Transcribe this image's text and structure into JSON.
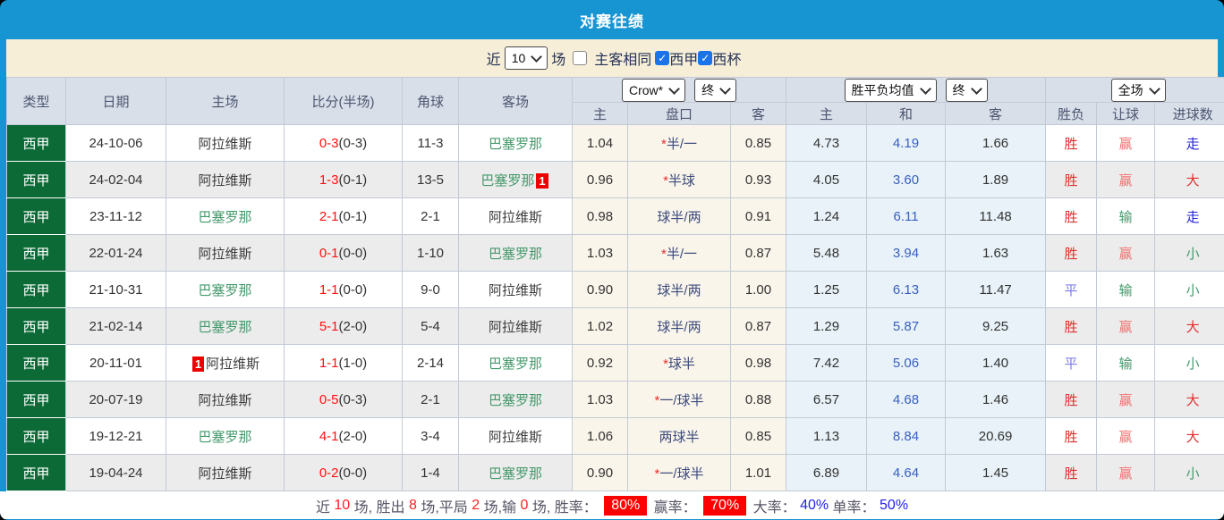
{
  "title": "对赛往绩",
  "filter": {
    "near_label": "近",
    "count_value": "10",
    "games_label": "场",
    "same_venue_label": "主客相同",
    "league_label": "西甲",
    "cup_label": "西杯"
  },
  "table": {
    "headers": {
      "type": "类型",
      "date": "日期",
      "home": "主场",
      "score": "比分(半场)",
      "corners": "角球",
      "away": "客场"
    },
    "selects": [
      {
        "label": "Crow*"
      },
      {
        "label": "终"
      },
      {
        "label": "胜平负均值"
      },
      {
        "label": "终"
      },
      {
        "label": "全场"
      }
    ],
    "subheaders": [
      "主",
      "盘口",
      "客",
      "主",
      "和",
      "客",
      "胜负",
      "让球",
      "进球数"
    ],
    "rows": [
      {
        "league": "西甲",
        "date": "24-10-06",
        "home": "阿拉维斯",
        "home_green": false,
        "home_badge": "",
        "score": "0-3",
        "half": "(0-3)",
        "corners": "11-3",
        "away": "巴塞罗那",
        "away_green": true,
        "away_badge": "",
        "odds1": "1.04",
        "handicap_star": true,
        "handicap": "半/一",
        "odds2": "0.85",
        "mean1": "4.73",
        "meanx": "4.19",
        "mean2": "1.66",
        "result": "胜",
        "result_c": "red",
        "let": "赢",
        "let_c": "pink",
        "goal": "走",
        "goal_c": "blue"
      },
      {
        "league": "西甲",
        "date": "24-02-04",
        "home": "阿拉维斯",
        "home_green": false,
        "home_badge": "",
        "score": "1-3",
        "half": "(0-1)",
        "corners": "13-5",
        "away": "巴塞罗那",
        "away_green": true,
        "away_badge": "1",
        "odds1": "0.96",
        "handicap_star": true,
        "handicap": "半球",
        "odds2": "0.93",
        "mean1": "4.05",
        "meanx": "3.60",
        "mean2": "1.89",
        "result": "胜",
        "result_c": "red",
        "let": "赢",
        "let_c": "pink",
        "goal": "大",
        "goal_c": "red"
      },
      {
        "league": "西甲",
        "date": "23-11-12",
        "home": "巴塞罗那",
        "home_green": true,
        "home_badge": "",
        "score": "2-1",
        "half": "(0-1)",
        "corners": "2-1",
        "away": "阿拉维斯",
        "away_green": false,
        "away_badge": "",
        "odds1": "0.98",
        "handicap_star": false,
        "handicap": "球半/两",
        "odds2": "0.91",
        "mean1": "1.24",
        "meanx": "6.11",
        "mean2": "11.48",
        "result": "胜",
        "result_c": "red",
        "let": "输",
        "let_c": "green",
        "goal": "走",
        "goal_c": "blue"
      },
      {
        "league": "西甲",
        "date": "22-01-24",
        "home": "阿拉维斯",
        "home_green": false,
        "home_badge": "",
        "score": "0-1",
        "half": "(0-0)",
        "corners": "1-10",
        "away": "巴塞罗那",
        "away_green": true,
        "away_badge": "",
        "odds1": "1.03",
        "handicap_star": true,
        "handicap": "半/一",
        "odds2": "0.87",
        "mean1": "5.48",
        "meanx": "3.94",
        "mean2": "1.63",
        "result": "胜",
        "result_c": "red",
        "let": "赢",
        "let_c": "pink",
        "goal": "小",
        "goal_c": "green"
      },
      {
        "league": "西甲",
        "date": "21-10-31",
        "home": "巴塞罗那",
        "home_green": true,
        "home_badge": "",
        "score": "1-1",
        "half": "(0-0)",
        "corners": "9-0",
        "away": "阿拉维斯",
        "away_green": false,
        "away_badge": "",
        "odds1": "0.90",
        "handicap_star": false,
        "handicap": "球半/两",
        "odds2": "1.00",
        "mean1": "1.25",
        "meanx": "6.13",
        "mean2": "11.47",
        "result": "平",
        "result_c": "purple",
        "let": "输",
        "let_c": "green",
        "goal": "小",
        "goal_c": "green"
      },
      {
        "league": "西甲",
        "date": "21-02-14",
        "home": "巴塞罗那",
        "home_green": true,
        "home_badge": "",
        "score": "5-1",
        "half": "(2-0)",
        "corners": "5-4",
        "away": "阿拉维斯",
        "away_green": false,
        "away_badge": "",
        "odds1": "1.02",
        "handicap_star": false,
        "handicap": "球半/两",
        "odds2": "0.87",
        "mean1": "1.29",
        "meanx": "5.87",
        "mean2": "9.25",
        "result": "胜",
        "result_c": "red",
        "let": "赢",
        "let_c": "pink",
        "goal": "大",
        "goal_c": "red"
      },
      {
        "league": "西甲",
        "date": "20-11-01",
        "home": "阿拉维斯",
        "home_green": false,
        "home_badge": "1",
        "score": "1-1",
        "half": "(1-0)",
        "corners": "2-14",
        "away": "巴塞罗那",
        "away_green": true,
        "away_badge": "",
        "odds1": "0.92",
        "handicap_star": true,
        "handicap": "球半",
        "odds2": "0.98",
        "mean1": "7.42",
        "meanx": "5.06",
        "mean2": "1.40",
        "result": "平",
        "result_c": "purple",
        "let": "输",
        "let_c": "green",
        "goal": "小",
        "goal_c": "green"
      },
      {
        "league": "西甲",
        "date": "20-07-19",
        "home": "阿拉维斯",
        "home_green": false,
        "home_badge": "",
        "score": "0-5",
        "half": "(0-3)",
        "corners": "2-1",
        "away": "巴塞罗那",
        "away_green": true,
        "away_badge": "",
        "odds1": "1.03",
        "handicap_star": true,
        "handicap": "一/球半",
        "odds2": "0.88",
        "mean1": "6.57",
        "meanx": "4.68",
        "mean2": "1.46",
        "result": "胜",
        "result_c": "red",
        "let": "赢",
        "let_c": "pink",
        "goal": "大",
        "goal_c": "red"
      },
      {
        "league": "西甲",
        "date": "19-12-21",
        "home": "巴塞罗那",
        "home_green": true,
        "home_badge": "",
        "score": "4-1",
        "half": "(2-0)",
        "corners": "3-4",
        "away": "阿拉维斯",
        "away_green": false,
        "away_badge": "",
        "odds1": "1.06",
        "handicap_star": false,
        "handicap": "两球半",
        "odds2": "0.85",
        "mean1": "1.13",
        "meanx": "8.84",
        "mean2": "20.69",
        "result": "胜",
        "result_c": "red",
        "let": "赢",
        "let_c": "pink",
        "goal": "大",
        "goal_c": "red"
      },
      {
        "league": "西甲",
        "date": "19-04-24",
        "home": "阿拉维斯",
        "home_green": false,
        "home_badge": "",
        "score": "0-2",
        "half": "(0-0)",
        "corners": "1-4",
        "away": "巴塞罗那",
        "away_green": true,
        "away_badge": "",
        "odds1": "0.90",
        "handicap_star": true,
        "handicap": "一/球半",
        "odds2": "1.01",
        "mean1": "6.89",
        "meanx": "4.64",
        "mean2": "1.45",
        "result": "胜",
        "result_c": "red",
        "let": "赢",
        "let_c": "pink",
        "goal": "小",
        "goal_c": "green"
      }
    ]
  },
  "summary": {
    "parts": [
      {
        "t": "近 ",
        "c": "label"
      },
      {
        "t": "10",
        "c": "num"
      },
      {
        "t": " 场, 胜出 ",
        "c": "label"
      },
      {
        "t": "8",
        "c": "num"
      },
      {
        "t": " 场,平局 ",
        "c": "label"
      },
      {
        "t": "2",
        "c": "num"
      },
      {
        "t": " 场,输 ",
        "c": "label"
      },
      {
        "t": "0",
        "c": "num"
      },
      {
        "t": " 场, 胜率： ",
        "c": "label"
      },
      {
        "t": "80%",
        "c": "badge"
      },
      {
        "t": " 赢率： ",
        "c": "label"
      },
      {
        "t": "70%",
        "c": "badge"
      },
      {
        "t": " 大率： ",
        "c": "label"
      },
      {
        "t": "40%",
        "c": "pct"
      },
      {
        "t": " 单率： ",
        "c": "label"
      },
      {
        "t": "50%",
        "c": "pct"
      }
    ]
  },
  "colors": {
    "top_bar_blue": "#1795d3",
    "filter_bar_cream": "#f7eed8",
    "header_gray_blue": "#d9dfe9",
    "league_green": "#0c6a37",
    "odds_cream": "#faf5ea",
    "mean_light_blue": "#e8f2f8",
    "score_red": "#ff1111",
    "team_green": "#44996b",
    "win_red": "#e03030",
    "draw_purple": "#7b7be8",
    "lose_green": "#44996b",
    "walk_blue": "#2525d2",
    "summary_badge_red": "#ff0000",
    "summary_pct_blue": "#2222e6",
    "checkbox_blue": "#1a73e8"
  }
}
